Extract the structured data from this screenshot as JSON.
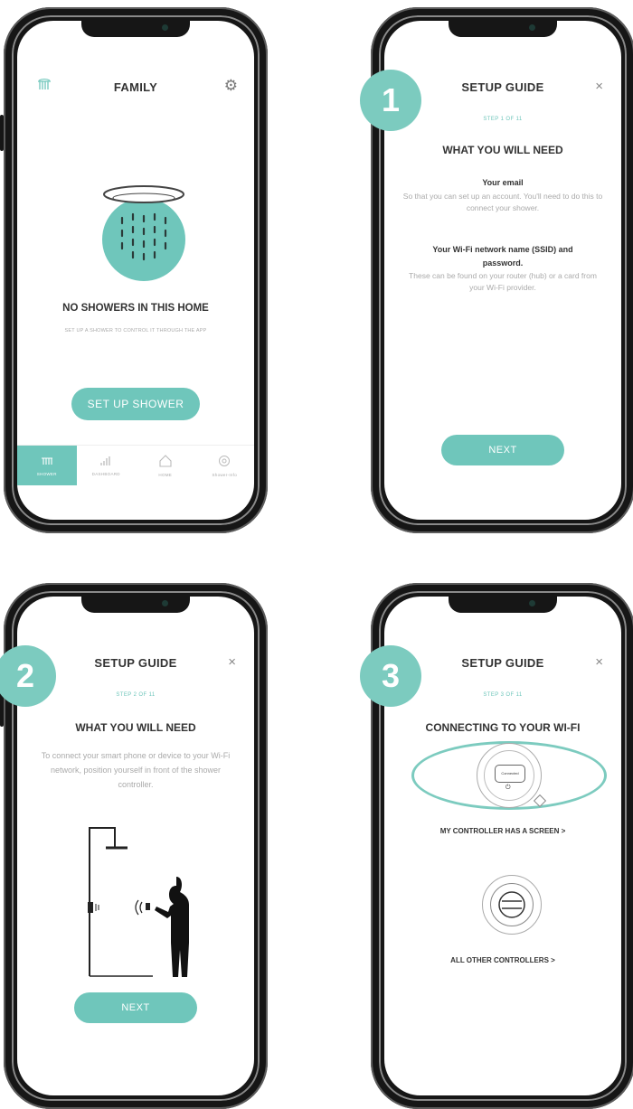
{
  "colors": {
    "accent": "#6fc6bb",
    "badge": "#7ccbbf",
    "frame": "#161616"
  },
  "screen1": {
    "title": "FAMILY",
    "left_icon": "shower-icon",
    "right_icon": "gear-icon",
    "empty_title": "NO SHOWERS IN THIS HOME",
    "empty_subtitle": "SET UP A SHOWER TO CONTROL IT THROUGH THE APP",
    "button": "SET UP SHOWER",
    "tabs": [
      {
        "label": "SHOWER",
        "icon": "shower-icon"
      },
      {
        "label": "DASHBOARD",
        "icon": "bar-chart-icon"
      },
      {
        "label": "HOME",
        "icon": "home-icon"
      },
      {
        "label": "Shower-Info",
        "icon": "info-icon"
      }
    ]
  },
  "screen2": {
    "badge": "1",
    "title": "SETUP GUIDE",
    "close": "×",
    "step": "STEP 1 OF 11",
    "heading": "WHAT YOU WILL NEED",
    "item1_title": "Your email",
    "item1_text": "So that you can set up an account. You'll need to do this to connect your shower.",
    "item2_title": "Your Wi-Fi network name (SSID) and password.",
    "item2_text": "These can be found on your router (hub) or a card from your Wi-Fi provider.",
    "button": "NEXT"
  },
  "screen3": {
    "badge": "2",
    "title": "SETUP GUIDE",
    "close": "×",
    "step": "STEP 2 OF 11",
    "heading": "WHAT YOU WILL NEED",
    "text": "To connect your smart phone or device to your Wi-Fi network, position yourself in front of the shower controller.",
    "button": "NEXT"
  },
  "screen4": {
    "badge": "3",
    "title": "SETUP GUIDE",
    "close": "×",
    "step": "STEP 3 OF 11",
    "heading": "CONNECTING TO YOUR WI-FI",
    "controller_screen_text": "Connected",
    "option1": "MY CONTROLLER HAS A SCREEN >",
    "option2": "ALL OTHER CONTROLLERS >"
  }
}
